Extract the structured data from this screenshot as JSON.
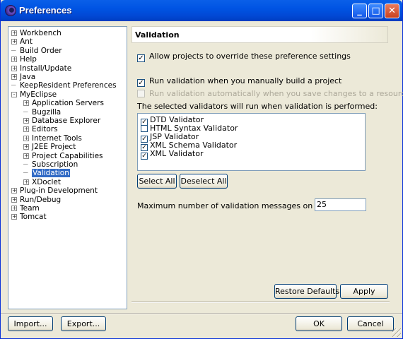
{
  "window": {
    "title": "Preferences",
    "icon": "eclipse-icon",
    "controls": [
      "minimize",
      "maximize",
      "close"
    ]
  },
  "tree": {
    "items": [
      {
        "label": "Workbench",
        "expander": "+",
        "level": 0
      },
      {
        "label": "Ant",
        "expander": "+",
        "level": 0
      },
      {
        "label": "Build Order",
        "expander": "",
        "level": 0
      },
      {
        "label": "Help",
        "expander": "+",
        "level": 0
      },
      {
        "label": "Install/Update",
        "expander": "+",
        "level": 0
      },
      {
        "label": "Java",
        "expander": "+",
        "level": 0
      },
      {
        "label": "KeepResident Preferences",
        "expander": "",
        "level": 0
      },
      {
        "label": "MyEclipse",
        "expander": "-",
        "level": 0
      },
      {
        "label": "Application Servers",
        "expander": "+",
        "level": 1
      },
      {
        "label": "Bugzilla",
        "expander": "",
        "level": 1
      },
      {
        "label": "Database Explorer",
        "expander": "+",
        "level": 1
      },
      {
        "label": "Editors",
        "expander": "+",
        "level": 1
      },
      {
        "label": "Internet Tools",
        "expander": "+",
        "level": 1
      },
      {
        "label": "J2EE Project",
        "expander": "+",
        "level": 1
      },
      {
        "label": "Project Capabilities",
        "expander": "+",
        "level": 1
      },
      {
        "label": "Subscription",
        "expander": "",
        "level": 1
      },
      {
        "label": "Validation",
        "expander": "",
        "level": 1,
        "selected": true
      },
      {
        "label": "XDoclet",
        "expander": "+",
        "level": 1
      },
      {
        "label": "Plug-in Development",
        "expander": "+",
        "level": 0
      },
      {
        "label": "Run/Debug",
        "expander": "+",
        "level": 0
      },
      {
        "label": "Team",
        "expander": "+",
        "level": 0
      },
      {
        "label": "Tomcat",
        "expander": "+",
        "level": 0
      }
    ]
  },
  "page": {
    "title": "Validation",
    "allow_override": {
      "label": "Allow projects to override these preference settings",
      "checked": true
    },
    "run_manual": {
      "label": "Run validation when you manually build a project",
      "checked": true
    },
    "run_auto": {
      "label": "Run validation automatically when you save changes to a resource",
      "checked": false,
      "enabled": false
    },
    "validators_caption": "The selected validators will run when validation is performed:",
    "validators": [
      {
        "label": "DTD Validator",
        "checked": true
      },
      {
        "label": "HTML Syntax Validator",
        "checked": false
      },
      {
        "label": "JSP Validator",
        "checked": true
      },
      {
        "label": "XML Schema Validator",
        "checked": true
      },
      {
        "label": "XML Validator",
        "checked": true
      }
    ],
    "select_all": "Select All",
    "deselect_all": "Deselect All",
    "max_messages_label": "Maximum number of validation messages on a project",
    "max_messages_value": "25",
    "restore_defaults": "Restore Defaults",
    "apply": "Apply"
  },
  "footer": {
    "import": "Import...",
    "export": "Export...",
    "ok": "OK",
    "cancel": "Cancel"
  },
  "colors": {
    "titlebar": "#0054e3",
    "selection": "#316ac5",
    "dialog_bg": "#ece9d8"
  }
}
